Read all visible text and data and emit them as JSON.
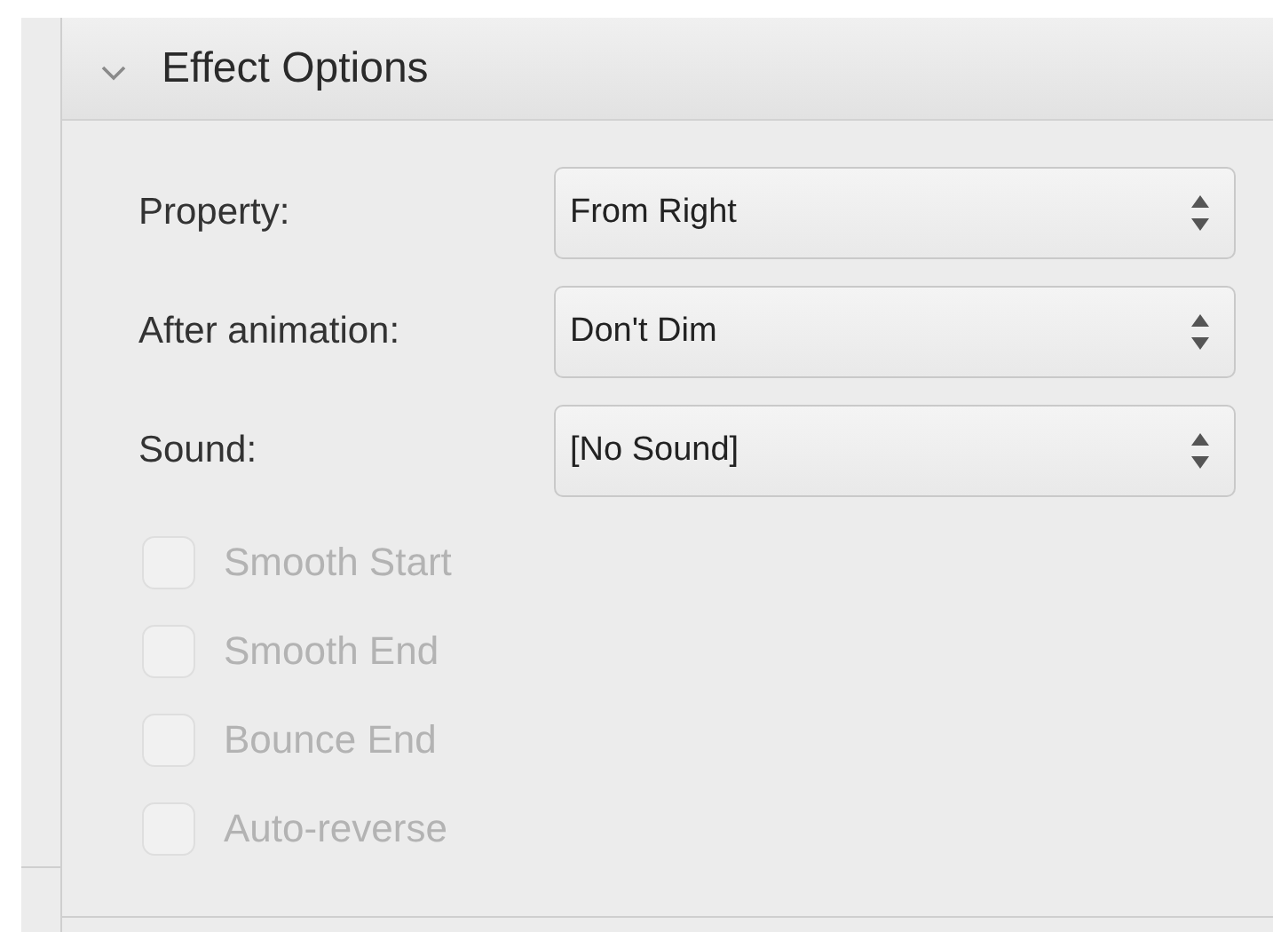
{
  "section": {
    "title": "Effect Options",
    "expanded": true
  },
  "fields": [
    {
      "label": "Property:",
      "value": "From Right"
    },
    {
      "label": "After animation:",
      "value": "Don't Dim"
    },
    {
      "label": "Sound:",
      "value": "[No Sound]"
    }
  ],
  "options": [
    {
      "label": "Smooth Start",
      "checked": false,
      "disabled": true
    },
    {
      "label": "Smooth End",
      "checked": false,
      "disabled": true
    },
    {
      "label": "Bounce End",
      "checked": false,
      "disabled": true
    },
    {
      "label": "Auto-reverse",
      "checked": false,
      "disabled": true
    }
  ]
}
